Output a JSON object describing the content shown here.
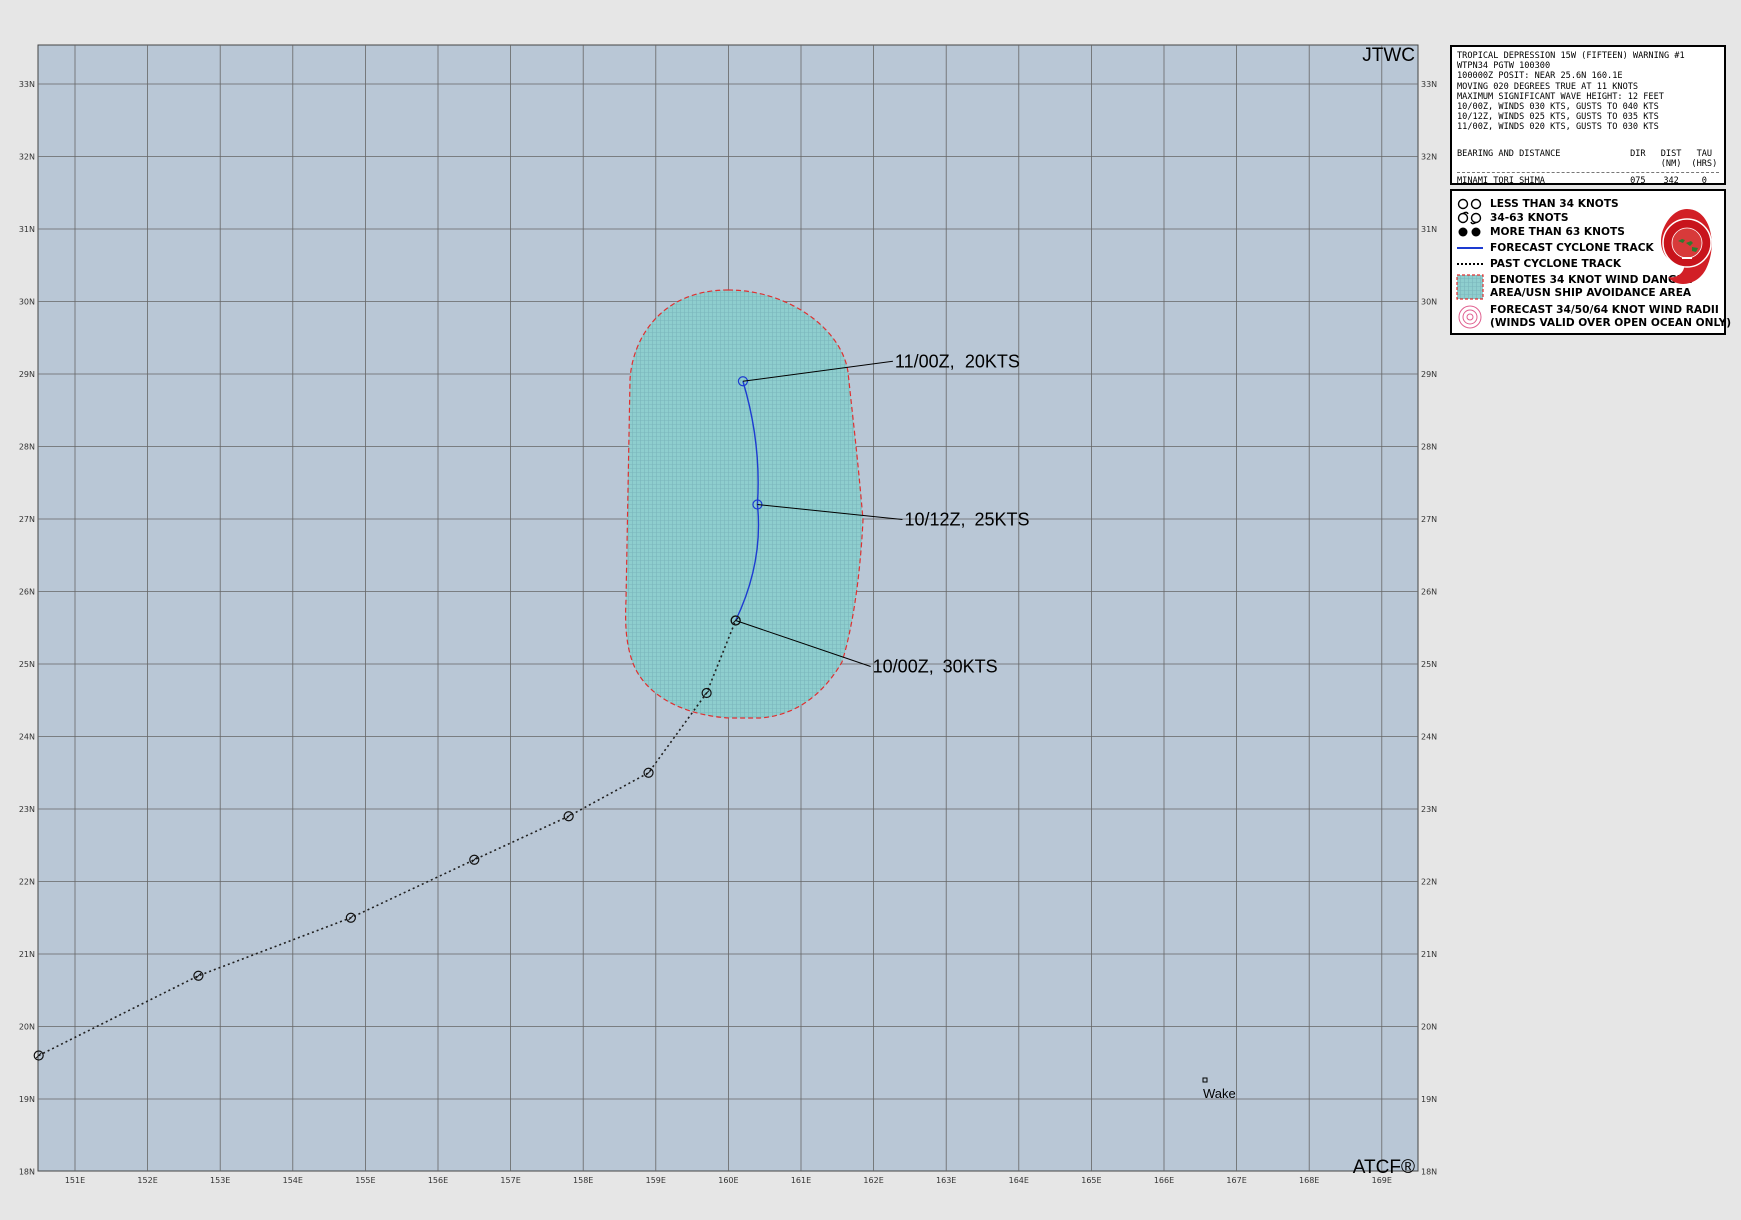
{
  "map": {
    "corner_top_right": "JTWC",
    "corner_bottom_right": "ATCF®",
    "lat_labels": [
      "33N",
      "32N",
      "31N",
      "30N",
      "29N",
      "28N",
      "27N",
      "26N",
      "25N",
      "24N",
      "23N",
      "22N",
      "21N",
      "20N",
      "19N",
      "18N"
    ],
    "lon_labels": [
      "151E",
      "152E",
      "153E",
      "154E",
      "155E",
      "156E",
      "157E",
      "158E",
      "159E",
      "160E",
      "161E",
      "162E",
      "163E",
      "164E",
      "165E",
      "166E",
      "167E",
      "168E",
      "169E"
    ],
    "place": "Wake",
    "forecast_labels": [
      {
        "time": "10/00Z,",
        "wind": "30KTS"
      },
      {
        "time": "10/12Z,",
        "wind": "25KTS"
      },
      {
        "time": "11/00Z,",
        "wind": "20KTS"
      }
    ],
    "past_track": [
      [
        150.5,
        19.6
      ],
      [
        152.7,
        20.7
      ],
      [
        154.8,
        21.5
      ],
      [
        156.5,
        22.3
      ],
      [
        157.8,
        22.9
      ],
      [
        158.9,
        23.5
      ],
      [
        159.7,
        24.6
      ],
      [
        160.1,
        25.6
      ]
    ],
    "forecast_track": [
      [
        160.1,
        25.6
      ],
      [
        160.4,
        27.2
      ],
      [
        160.2,
        28.9
      ]
    ],
    "colors": {
      "ocean": "#b9c7d6",
      "danger_area": "#8ecece",
      "danger_border": "#e03030",
      "forecast_track": "#1d3bd1",
      "past_track": "#202020",
      "grid": "#666666"
    }
  },
  "warning": {
    "lines": [
      "TROPICAL DEPRESSION 15W (FIFTEEN) WARNING #1",
      "WTPN34 PGTW 100300",
      "100000Z POSIT: NEAR 25.6N 160.1E",
      "MOVING 020 DEGREES TRUE AT 11 KNOTS",
      "MAXIMUM SIGNIFICANT WAVE HEIGHT: 12 FEET",
      "10/00Z, WINDS 030 KTS, GUSTS TO 040 KTS",
      "10/12Z, WINDS 025 KTS, GUSTS TO 035 KTS",
      "11/00Z, WINDS 020 KTS, GUSTS TO 030 KTS"
    ],
    "bearing_header": {
      "label": "BEARING AND DISTANCE",
      "dir": "DIR",
      "dist": "DIST",
      "dist_unit": "(NM)",
      "tau": "TAU",
      "tau_unit": "(HRS)"
    },
    "bearing_row": {
      "name": "MINAMI_TORI_SHIMA",
      "dir": "075",
      "dist": "342",
      "tau": "0"
    }
  },
  "legend": {
    "items": [
      {
        "icon": "cyclone-symbol-weak-icon",
        "label": "LESS THAN 34 KNOTS"
      },
      {
        "icon": "cyclone-symbol-moderate-icon",
        "label": "34-63 KNOTS"
      },
      {
        "icon": "cyclone-symbol-strong-icon",
        "label": "MORE THAN 63 KNOTS"
      },
      {
        "icon": "forecast-track-line-icon",
        "label": "FORECAST CYCLONE TRACK"
      },
      {
        "icon": "past-track-dotted-icon",
        "label": "PAST CYCLONE TRACK"
      },
      {
        "icon": "danger-area-swatch-icon",
        "label": "DENOTES 34 KNOT WIND DANGER",
        "label2": "AREA/USN SHIP AVOIDANCE AREA"
      },
      {
        "icon": "wind-radii-icon",
        "label": "FORECAST 34/50/64 KNOT WIND RADII",
        "label2": "(WINDS VALID OVER OPEN OCEAN ONLY)"
      }
    ]
  }
}
